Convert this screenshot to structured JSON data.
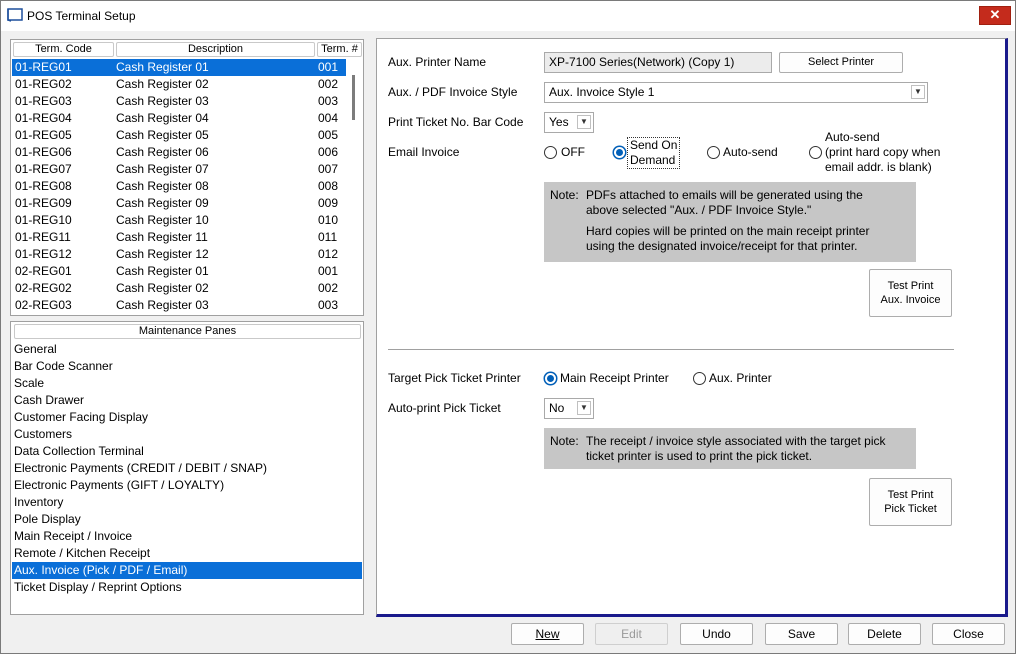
{
  "window": {
    "title": "POS Terminal Setup",
    "close_glyph": "✕",
    "app_icon": "window-icon"
  },
  "terminals": {
    "headers": {
      "code": "Term. Code",
      "description": "Description",
      "num": "Term. #"
    },
    "rows": [
      {
        "code": "01-REG01",
        "description": "Cash Register 01",
        "num": "001"
      },
      {
        "code": "01-REG02",
        "description": "Cash Register 02",
        "num": "002"
      },
      {
        "code": "01-REG03",
        "description": "Cash Register 03",
        "num": "003"
      },
      {
        "code": "01-REG04",
        "description": "Cash Register 04",
        "num": "004"
      },
      {
        "code": "01-REG05",
        "description": "Cash Register 05",
        "num": "005"
      },
      {
        "code": "01-REG06",
        "description": "Cash Register 06",
        "num": "006"
      },
      {
        "code": "01-REG07",
        "description": "Cash Register 07",
        "num": "007"
      },
      {
        "code": "01-REG08",
        "description": "Cash Register 08",
        "num": "008"
      },
      {
        "code": "01-REG09",
        "description": "Cash Register 09",
        "num": "009"
      },
      {
        "code": "01-REG10",
        "description": "Cash Register 10",
        "num": "010"
      },
      {
        "code": "01-REG11",
        "description": "Cash Register 11",
        "num": "011"
      },
      {
        "code": "01-REG12",
        "description": "Cash Register 12",
        "num": "012"
      },
      {
        "code": "02-REG01",
        "description": "Cash Register 01",
        "num": "001"
      },
      {
        "code": "02-REG02",
        "description": "Cash Register 02",
        "num": "002"
      },
      {
        "code": "02-REG03",
        "description": "Cash Register 03",
        "num": "003"
      }
    ]
  },
  "panes": {
    "header": "Maintenance Panes",
    "items": [
      "General",
      "Bar Code Scanner",
      "Scale",
      "Cash Drawer",
      "Customer Facing Display",
      "Customers",
      "Data Collection Terminal",
      "Electronic Payments (CREDIT / DEBIT / SNAP)",
      "Electronic Payments (GIFT /  LOYALTY)",
      "Inventory",
      "Pole Display",
      "Main Receipt / Invoice",
      "Remote / Kitchen Receipt",
      "Aux. Invoice (Pick / PDF / Email)",
      "Ticket Display / Reprint Options"
    ]
  },
  "form": {
    "aux_printer_label": "Aux. Printer Name",
    "aux_printer_value": "XP-7100 Series(Network) (Copy 1)",
    "select_printer_button": "Select Printer",
    "invoice_style_label": "Aux. / PDF Invoice Style",
    "invoice_style_value": "Aux. Invoice Style 1",
    "barcode_label": "Print Ticket No. Bar Code",
    "barcode_value": "Yes",
    "email_label": "Email Invoice",
    "email_options": {
      "off": "OFF",
      "send_on_demand_1": "Send On",
      "send_on_demand_2": "Demand",
      "auto_send": "Auto-send",
      "auto_send_blank_1": "Auto-send",
      "auto_send_blank_2": "(print hard copy when",
      "auto_send_blank_3": "email addr. is blank)"
    },
    "email_selected": "send_on_demand",
    "note1": {
      "label": "Note:",
      "line1": "PDFs attached to emails will be generated using the",
      "line2": "above selected \"Aux. / PDF Invoice Style.\"",
      "line3": "Hard copies will be printed on the main receipt printer",
      "line4": "using the designated invoice/receipt for that printer."
    },
    "test_print_aux_1": "Test Print",
    "test_print_aux_2": "Aux. Invoice",
    "pick_printer_label": "Target Pick Ticket Printer",
    "pick_options": {
      "main": "Main Receipt Printer",
      "aux": "Aux. Printer"
    },
    "pick_selected": "main",
    "autoprint_label": "Auto-print Pick Ticket",
    "autoprint_value": "No",
    "note2": {
      "label": "Note:",
      "line1": "The receipt / invoice style associated with the target pick",
      "line2": "ticket printer is used to print the pick ticket."
    },
    "test_print_pick_1": "Test Print",
    "test_print_pick_2": "Pick Ticket"
  },
  "buttons": {
    "new": "New",
    "edit": "Edit",
    "undo": "Undo",
    "save": "Save",
    "delete": "Delete",
    "close": "Close"
  },
  "colors": {
    "selection": "#0a6fd8",
    "accent_border": "#1a1a8c",
    "close_red": "#c42b1c",
    "note_bg": "#c6c6c6"
  }
}
